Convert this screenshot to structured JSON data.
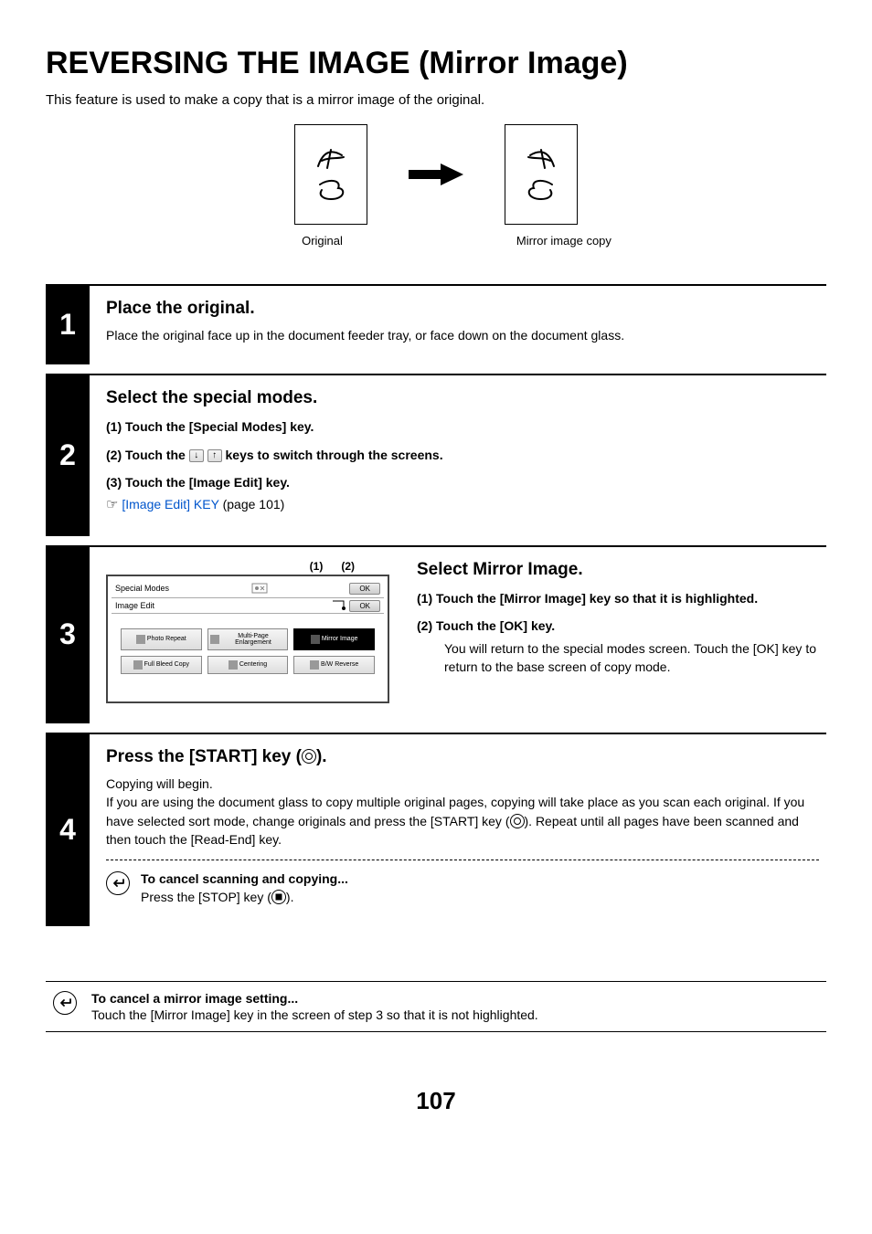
{
  "title": "REVERSING THE IMAGE (Mirror Image)",
  "intro": "This feature is used to make a copy that is a mirror image of the original.",
  "illus": {
    "label_left": "Original",
    "label_right": "Mirror image copy"
  },
  "step1": {
    "num": "1",
    "heading": "Place the original.",
    "body": "Place the original face up in the document feeder tray, or face down on the document glass."
  },
  "step2": {
    "num": "2",
    "heading": "Select the special modes.",
    "items": {
      "i1": "(1)  Touch the [Special Modes] key.",
      "i2a": "(2)  Touch the ",
      "i2b": " keys to switch through the screens.",
      "i3": "(3)  Touch the [Image Edit] key."
    },
    "ref_link": "[Image Edit] KEY",
    "ref_page": " (page 101)"
  },
  "step3": {
    "num": "3",
    "callout1": "(1)",
    "callout2": "(2)",
    "panel": {
      "title": "Special Modes",
      "sub": "Image Edit",
      "ok": "OK",
      "tiles": {
        "t1": "Photo Repeat",
        "t2": "Multi-Page Enlargement",
        "t3": "Mirror Image",
        "t4": "Full Bleed Copy",
        "t5": "Centering",
        "t6": "B/W Reverse"
      }
    },
    "heading": "Select Mirror Image.",
    "s1": "(1)  Touch the [Mirror Image] key so that it is highlighted.",
    "s2": "(2)  Touch the [OK] key.",
    "s2_desc": "You will return to the special modes screen. Touch the [OK] key to return to the base screen of copy mode."
  },
  "step4": {
    "num": "4",
    "heading_a": "Press the [START] key (",
    "heading_b": ").",
    "body1": "Copying will begin.",
    "body2a": "If you are using the document glass to copy multiple original pages, copying will take place as you scan each original. If you have selected sort mode, change originals and press the [START] key (",
    "body2b": "). Repeat until all pages have been scanned and then touch the [Read-End] key.",
    "cancel_title": "To cancel scanning and copying...",
    "cancel_body_a": "Press the [STOP] key (",
    "cancel_body_b": ")."
  },
  "note": {
    "title": "To cancel a mirror image setting...",
    "body": "Touch the [Mirror Image] key in the screen of step 3 so that it is not highlighted."
  },
  "page_number": "107"
}
